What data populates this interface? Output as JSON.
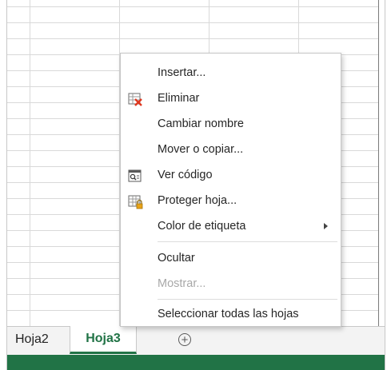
{
  "tabs": {
    "sheets": [
      "Hoja2",
      "Hoja3"
    ],
    "active": "Hoja3",
    "add_sheet_symbol": "+"
  },
  "context_menu": {
    "items": [
      {
        "label": "Insertar...",
        "mnemonic": "I",
        "icon": null,
        "disabled": false
      },
      {
        "label": "Eliminar",
        "mnemonic": "E",
        "icon": "delete-sheet-icon",
        "disabled": false
      },
      {
        "label": "Cambiar nombre",
        "mnemonic": "C",
        "icon": null,
        "disabled": false
      },
      {
        "label": "Mover o copiar...",
        "mnemonic": "M",
        "icon": null,
        "disabled": false
      },
      {
        "label": "Ver código",
        "mnemonic": "V",
        "icon": "view-code-icon",
        "disabled": false
      },
      {
        "label": "Proteger hoja...",
        "mnemonic": "h",
        "icon": "protect-sheet-icon",
        "disabled": false
      },
      {
        "label": "Color de etiqueta",
        "mnemonic": "t",
        "icon": null,
        "submenu": true,
        "disabled": false
      },
      {
        "label": "Ocultar",
        "mnemonic": "u",
        "icon": null,
        "disabled": false
      },
      {
        "label": "Mostrar...",
        "mnemonic": "a",
        "icon": null,
        "disabled": true
      },
      {
        "label": "Seleccionar todas las hojas",
        "mnemonic": "S",
        "icon": null,
        "disabled": false
      }
    ]
  },
  "colors": {
    "accent": "#217346",
    "grid_line": "#d9d9d9",
    "disabled_text": "#a8a8a8",
    "delete_x": "#e0371f",
    "lock": "#e8a317"
  }
}
